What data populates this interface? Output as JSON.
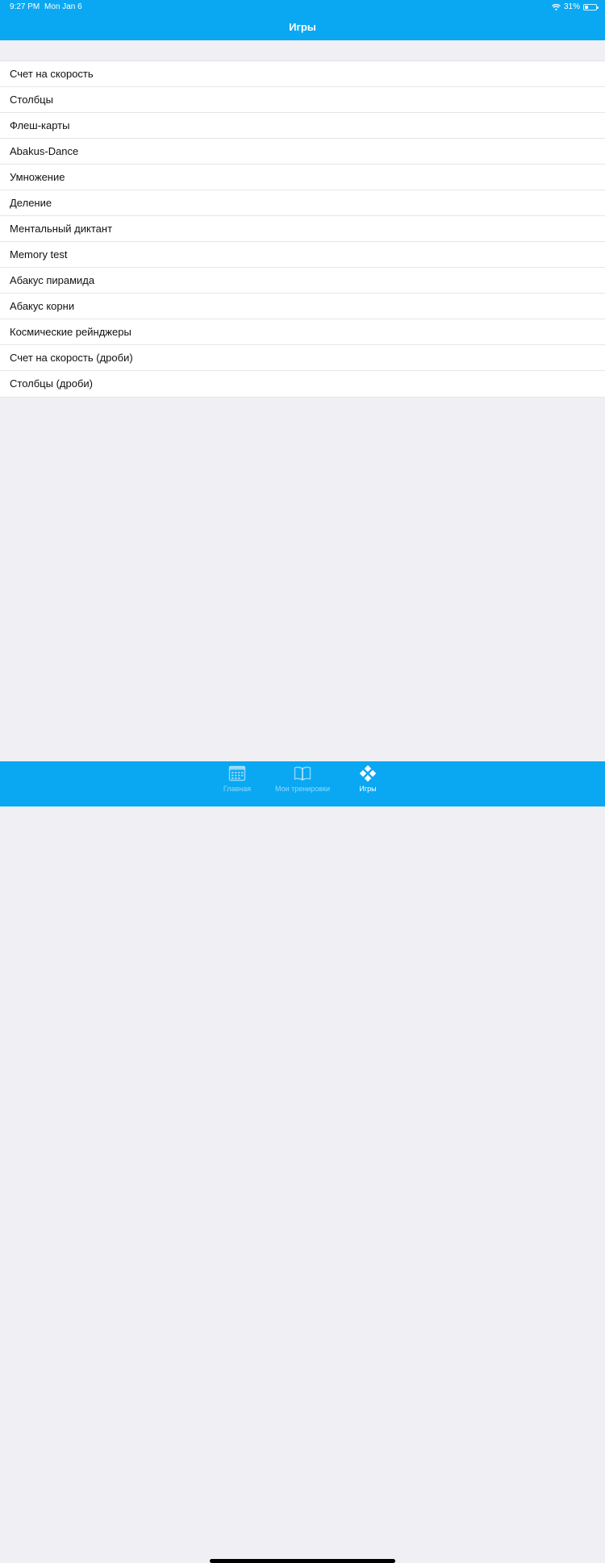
{
  "status_bar": {
    "time": "9:27 PM",
    "date": "Mon Jan 6",
    "battery": "31%",
    "battery_level": 0.31
  },
  "header": {
    "title": "Игры"
  },
  "games": [
    "Счет на скорость",
    "Столбцы",
    "Флеш-карты",
    "Abakus-Dance",
    "Умножение",
    "Деление",
    "Ментальный диктант",
    "Memory test",
    "Абакус пирамида",
    "Абакус корни",
    "Космические рейнджеры",
    "Счет на скорость (дроби)",
    "Столбцы (дроби)"
  ],
  "tabs": [
    {
      "label": "Главная",
      "icon": "calendar-icon",
      "active": false
    },
    {
      "label": "Мои тренировки",
      "icon": "book-icon",
      "active": false
    },
    {
      "label": "Игры",
      "icon": "gamepad-icon",
      "active": true
    }
  ],
  "colors": {
    "accent": "#0AA8F2",
    "background": "#EFEFF4"
  }
}
